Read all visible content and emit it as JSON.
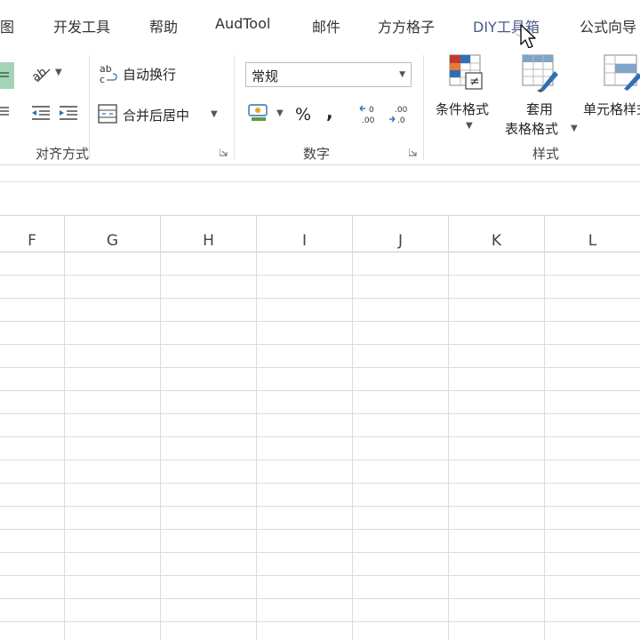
{
  "tabs": [
    {
      "label": "视图",
      "name": "tab-view"
    },
    {
      "label": "开发工具",
      "name": "tab-developer"
    },
    {
      "label": "帮助",
      "name": "tab-help"
    },
    {
      "label": "AudTool",
      "name": "tab-audtool"
    },
    {
      "label": "邮件",
      "name": "tab-mail"
    },
    {
      "label": "方方格子",
      "name": "tab-fangfanggezi"
    },
    {
      "label": "DIY工具箱",
      "name": "tab-diy-toolbox"
    },
    {
      "label": "公式向导",
      "name": "tab-formula-wizard"
    }
  ],
  "alignment": {
    "group_label": "对齐方式",
    "wrap_text_label": "自动换行",
    "merge_center_label": "合并后居中"
  },
  "number": {
    "group_label": "数字",
    "format_value": "常规",
    "percent_label": "%",
    "comma_label": ","
  },
  "styles": {
    "group_label": "样式",
    "conditional_format_label": "条件格式",
    "table_format_line1": "套用",
    "table_format_line2": "表格格式",
    "cell_styles_label": "单元格样式"
  },
  "columns": [
    "F",
    "G",
    "H",
    "I",
    "J",
    "K",
    "L"
  ],
  "colors": {
    "accent_green": "#217346",
    "icon_blue": "#2f6fb8",
    "icon_red": "#c0392b"
  }
}
